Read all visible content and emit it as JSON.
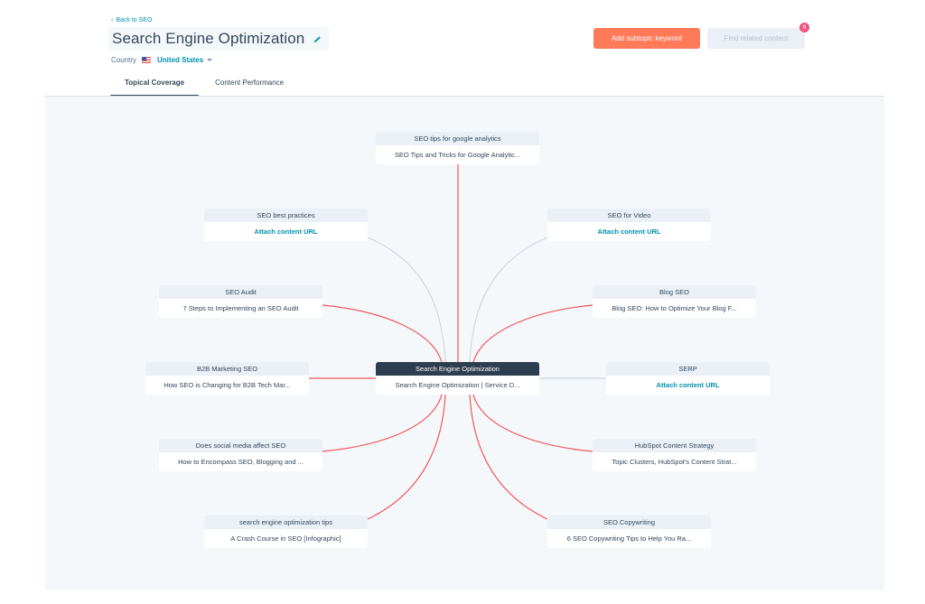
{
  "header": {
    "back_link": "Back to SEO",
    "back_chevron": "‹",
    "title": "Search Engine Optimization",
    "country_label": "Country",
    "country_value": "United States",
    "country_flag": "us-flag"
  },
  "toolbar": {
    "add_subtopic_label": "Add subtopic keyword",
    "find_related_label": "Find related content",
    "notification_count": "0"
  },
  "tabs": [
    {
      "label": "Topical Coverage",
      "active": true
    },
    {
      "label": "Content Performance",
      "active": false
    }
  ],
  "colors": {
    "accent": "#ff7a59",
    "link": "#0091ae",
    "center_header": "#2d3e50",
    "edge_linked": "#f2545b",
    "edge_unlinked": "#cbd6e2",
    "canvas_bg": "#f5f8fa"
  },
  "cluster": {
    "pillar": {
      "topic": "Search Engine Optimization",
      "content": "Search Engine Optimization | Service D..."
    },
    "subtopics": [
      {
        "topic": "SEO tips for google analytics",
        "content": "SEO Tips and Tricks for Google Analytic...",
        "linked": true
      },
      {
        "topic": "SEO best practices",
        "content": "Attach content URL",
        "linked": false
      },
      {
        "topic": "SEO for Video",
        "content": "Attach content URL",
        "linked": false
      },
      {
        "topic": "SEO Audit",
        "content": "7 Steps to Implementing an SEO Audit",
        "linked": true
      },
      {
        "topic": "Blog SEO",
        "content": "Blog SEO: How to Optimize Your Blog F...",
        "linked": true
      },
      {
        "topic": "B2B Marketing SEO",
        "content": "How SEO is Changing for B2B Tech Mar...",
        "linked": true
      },
      {
        "topic": "SERP",
        "content": "Attach content URL",
        "linked": false
      },
      {
        "topic": "Does social media affect SEO",
        "content": "How to Encompass SEO, Blogging and ...",
        "linked": true
      },
      {
        "topic": "HubSpot Content Strategy",
        "content": "Topic Clusters, HubSpot's Content Strat...",
        "linked": true
      },
      {
        "topic": "search engine optimization tips",
        "content": "A Crash Course in SEO [Infographic]",
        "linked": true
      },
      {
        "topic": "SEO Copywriting",
        "content": "6 SEO Copywriting Tips to Help You Ra...",
        "linked": true
      }
    ]
  }
}
